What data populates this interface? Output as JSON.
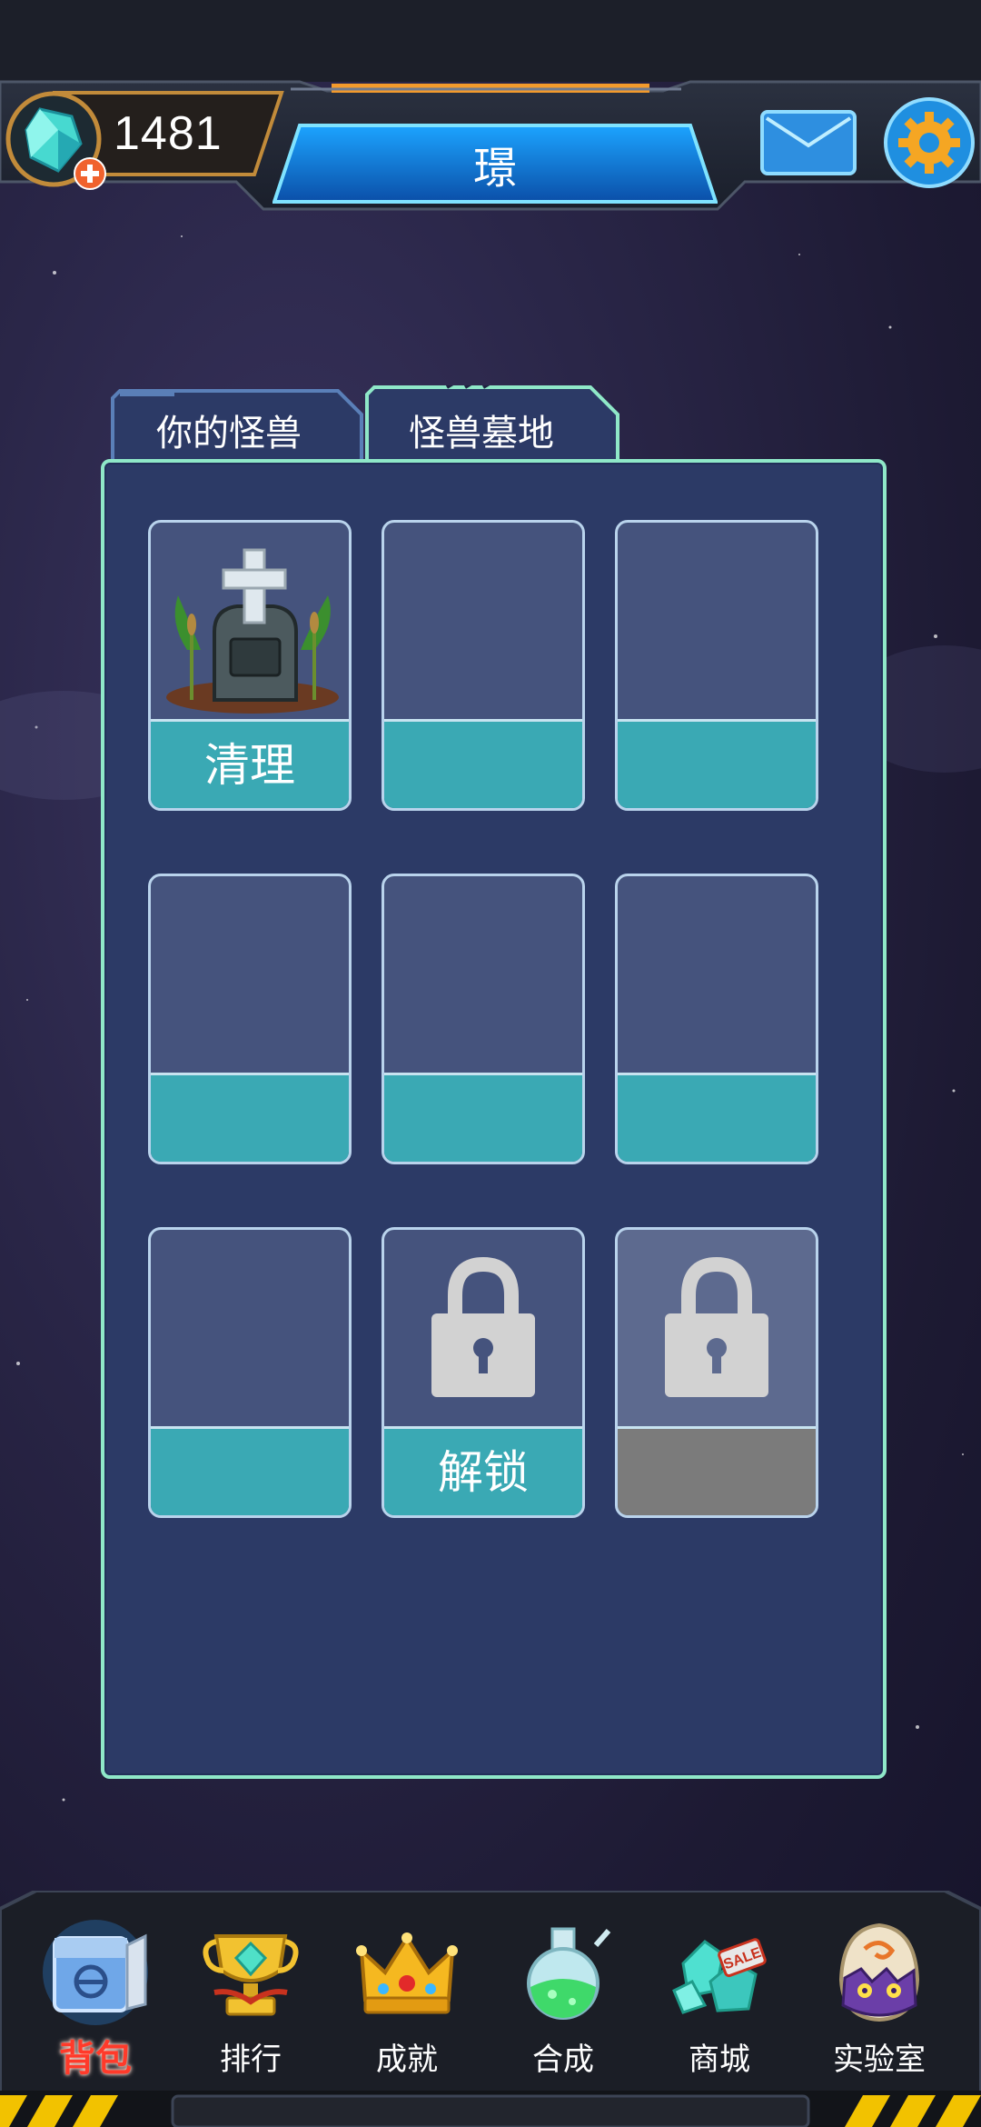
{
  "header": {
    "gem_count": "1481",
    "title": "璟"
  },
  "tabs": [
    {
      "label": "你的怪兽",
      "active": false
    },
    {
      "label": "怪兽墓地",
      "active": true
    }
  ],
  "slots": [
    {
      "label": "清理",
      "state": "grave"
    },
    {
      "label": "",
      "state": "empty"
    },
    {
      "label": "",
      "state": "empty"
    },
    {
      "label": "",
      "state": "empty"
    },
    {
      "label": "",
      "state": "empty"
    },
    {
      "label": "",
      "state": "empty"
    },
    {
      "label": "",
      "state": "empty"
    },
    {
      "label": "解锁",
      "state": "locked"
    },
    {
      "label": "",
      "state": "locked-disabled"
    }
  ],
  "nav": [
    {
      "label": "背包",
      "icon": "backpack-icon",
      "active": true
    },
    {
      "label": "排行",
      "icon": "trophy-icon",
      "active": false
    },
    {
      "label": "成就",
      "icon": "crown-icon",
      "active": false
    },
    {
      "label": "合成",
      "icon": "potion-flask-icon",
      "active": false
    },
    {
      "label": "商城",
      "icon": "shop-crystal-sale-icon",
      "active": false
    },
    {
      "label": "实验室",
      "icon": "monster-egg-icon",
      "active": false
    }
  ],
  "colors": {
    "panel_bg": "#2c3a66",
    "panel_border": "#8fe8c8",
    "slot_bottom": "#3aa9b4",
    "active_nav_label": "#ff3a2a"
  }
}
